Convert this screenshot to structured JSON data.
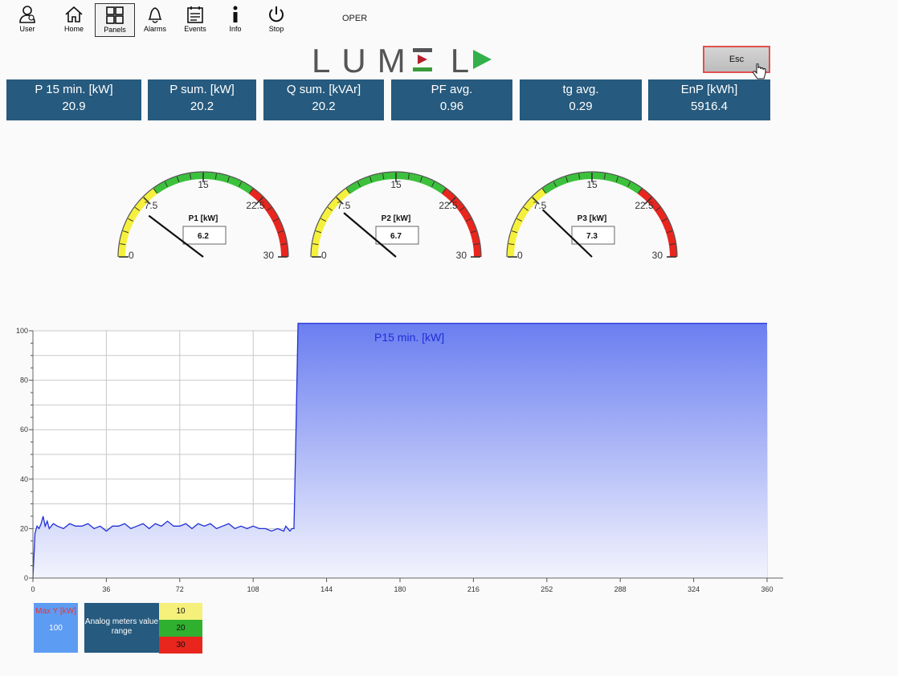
{
  "toolbar": {
    "items": [
      {
        "label": "User",
        "icon": "user-icon"
      },
      {
        "label": "Home",
        "icon": "home-icon"
      },
      {
        "label": "Panels",
        "icon": "panels-icon"
      },
      {
        "label": "Alarms",
        "icon": "bell-icon"
      },
      {
        "label": "Events",
        "icon": "events-icon"
      },
      {
        "label": "Info",
        "icon": "info-icon"
      },
      {
        "label": "Stop",
        "icon": "power-icon"
      }
    ],
    "mode": "OPER"
  },
  "logo": {
    "text": "LUMEL"
  },
  "esc_label": "Esc",
  "tiles": [
    {
      "label": "P 15 min. [kW]",
      "value": "20.9"
    },
    {
      "label": "P sum. [kW]",
      "value": "20.2"
    },
    {
      "label": "Q sum. [kVAr]",
      "value": "20.2"
    },
    {
      "label": "PF avg.",
      "value": "0.96"
    },
    {
      "label": "tg avg.",
      "value": "0.29"
    },
    {
      "label": "EnP [kWh]",
      "value": "5916.4"
    }
  ],
  "gauges": [
    {
      "title": "P1 [kW]",
      "value": "6.2",
      "needle": 6.2
    },
    {
      "title": "P2 [kW]",
      "value": "6.7",
      "needle": 6.7
    },
    {
      "title": "P3 [kW]",
      "value": "7.3",
      "needle": 7.3
    }
  ],
  "gauge_ticks": [
    "0",
    "7.5",
    "15",
    "22.5",
    "30"
  ],
  "gauge_max": 30,
  "colors": {
    "tile": "#265a7e",
    "yellow": "#f5f03c",
    "green": "#3cc13c",
    "red": "#e8261e",
    "series": "#1f2fd6",
    "esc_border": "#e05050"
  },
  "chart_data": {
    "type": "area",
    "series": [
      {
        "name": "P15 min. [kW]",
        "color": "#1f2fd6"
      }
    ],
    "xticks": [
      "0",
      "36",
      "72",
      "108",
      "144",
      "180",
      "216",
      "252",
      "288",
      "324",
      "360"
    ],
    "yticks": [
      "0",
      "20",
      "40",
      "60",
      "80",
      "100"
    ],
    "xlim": [
      0,
      360
    ],
    "ylim": [
      0,
      100
    ],
    "grid": true,
    "x": [
      0,
      1,
      2,
      3,
      4,
      5,
      6,
      7,
      8,
      9,
      10,
      12,
      15,
      18,
      21,
      24,
      27,
      30,
      33,
      36,
      39,
      42,
      45,
      48,
      51,
      54,
      57,
      60,
      63,
      66,
      69,
      72,
      75,
      78,
      81,
      84,
      87,
      90,
      93,
      96,
      99,
      102,
      105,
      108,
      111,
      114,
      117,
      120,
      123,
      124,
      125,
      126,
      127,
      128,
      129,
      130,
      131,
      132,
      360
    ],
    "y": [
      0,
      18,
      21,
      20,
      22,
      25,
      21,
      23,
      20,
      21,
      22,
      21,
      20,
      22,
      21,
      21,
      22,
      20,
      21,
      19,
      21,
      21,
      22,
      20,
      21,
      22,
      20,
      22,
      21,
      23,
      21,
      21,
      22,
      20,
      22,
      21,
      22,
      20,
      21,
      22,
      20,
      21,
      20,
      21,
      20,
      20,
      19,
      20,
      19,
      21,
      20,
      19,
      20,
      20,
      60,
      103,
      103,
      103,
      103
    ],
    "legend": {
      "max_y_label": "Max Y [kW]",
      "max_y_value": "100",
      "range_label": "Analog meters value range",
      "ranges": [
        "10",
        "20",
        "30"
      ]
    }
  }
}
